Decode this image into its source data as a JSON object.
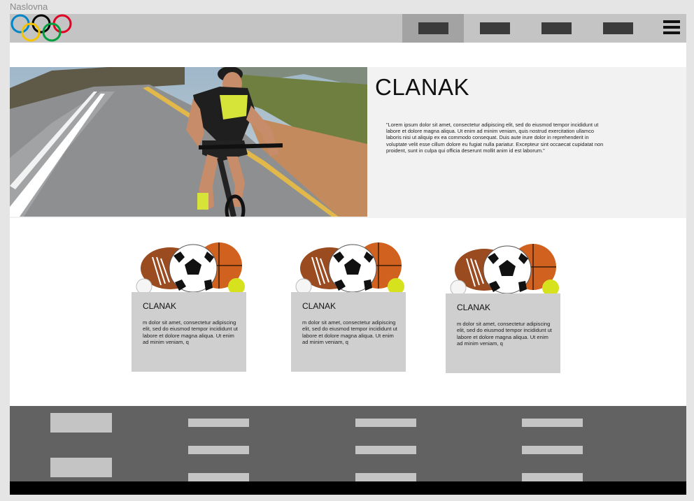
{
  "frame": {
    "label": "Naslovna"
  },
  "header": {
    "nav_items": [
      {
        "name": "nav-item-1",
        "active": true
      },
      {
        "name": "nav-item-2",
        "active": false
      },
      {
        "name": "nav-item-3",
        "active": false
      },
      {
        "name": "nav-item-4",
        "active": false
      }
    ],
    "menu_icon": "hamburger-menu-icon",
    "logo_icon": "olympic-rings-logo"
  },
  "hero": {
    "title": "CLANAK",
    "text": "\"Lorem ipsum dolor sit amet, consectetur adipiscing elit, sed do eiusmod tempor incididunt ut labore et dolore magna aliqua. Ut enim ad minim veniam, quis nostrud exercitation ullamco laboris nisi ut aliquip ex ea commodo consequat. Duis aute irure dolor in reprehenderit in voluptate velit esse cillum dolore eu fugiat nulla pariatur. Excepteur sint occaecat cupidatat non proident, sunt in culpa qui officia deserunt mollit anim id est laborum.\"",
    "image": "cyclist-photo"
  },
  "cards": [
    {
      "title": "CLANAK",
      "text": "m dolor sit amet, consectetur adipiscing elit, sed do eiusmod tempor incididunt ut labore et dolore magna aliqua. Ut enim ad minim veniam, q",
      "image": "sports-balls-image"
    },
    {
      "title": "CLANAK",
      "text": "m dolor sit amet, consectetur adipiscing elit, sed do eiusmod tempor incididunt ut labore et dolore magna aliqua. Ut enim ad minim veniam, q",
      "image": "sports-balls-image"
    },
    {
      "title": "CLANAK",
      "text": "m dolor sit amet, consectetur adipiscing elit, sed do eiusmod tempor incididunt ut labore et dolore magna aliqua. Ut enim ad minim veniam, q",
      "image": "sports-balls-image"
    }
  ],
  "colors": {
    "header_bg": "#c4c4c4",
    "nav_active_bg": "#a3a3a3",
    "hero_bg": "#f2f2f2",
    "card_bg": "#cfcfcf",
    "footer_bg": "#626262",
    "bottom_bar": "#000000",
    "olympic_blue": "#0085c7",
    "olympic_yellow": "#f4c300",
    "olympic_black": "#000000",
    "olympic_green": "#009f3d",
    "olympic_red": "#df0024"
  }
}
